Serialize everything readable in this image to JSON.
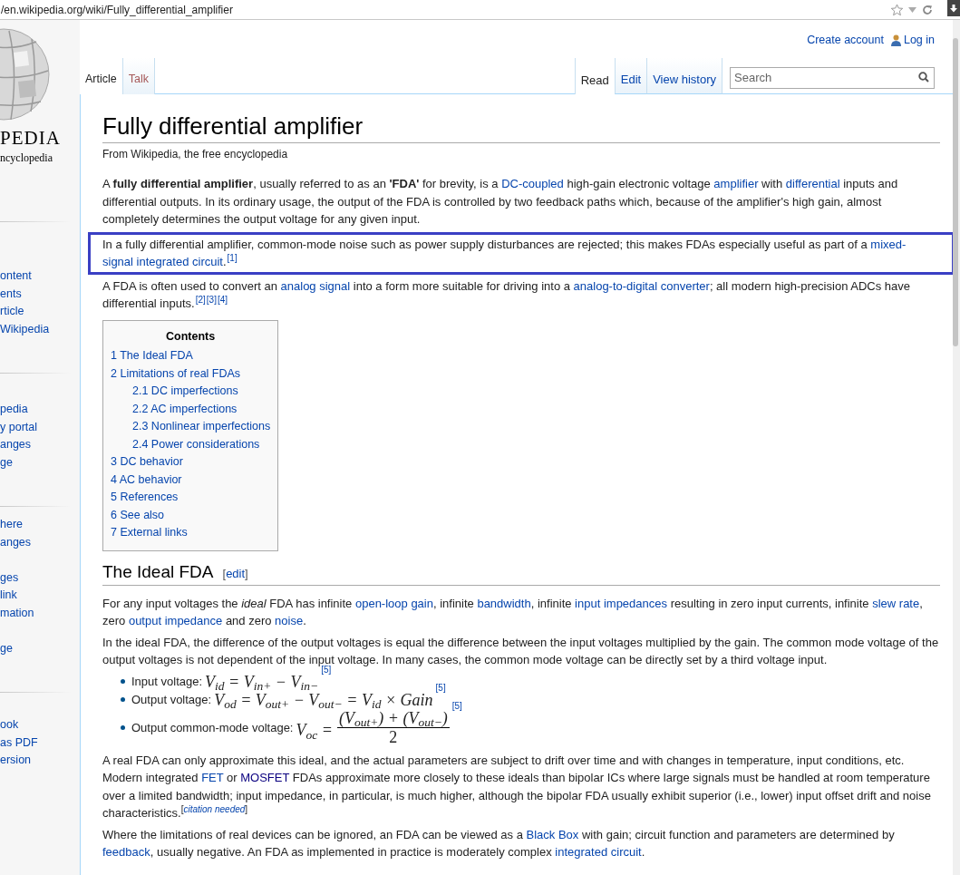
{
  "browser": {
    "url": "/en.wikipedia.org/wiki/Fully_differential_amplifier"
  },
  "logo": {
    "wordmark": "PEDIA",
    "tagline": "ncyclopedia"
  },
  "sidebar": {
    "sections": [
      {
        "items": [
          {
            "label": "ontent"
          },
          {
            "label": "ents"
          },
          {
            "label": "rticle"
          },
          {
            "label": "Wikipedia"
          }
        ]
      },
      {
        "items": [
          {
            "label": "pedia"
          },
          {
            "label": "y portal"
          },
          {
            "label": "anges"
          },
          {
            "label": "ge"
          }
        ]
      },
      {
        "items": [
          {
            "label": "here"
          },
          {
            "label": "anges"
          },
          {
            "label": "ges",
            "gap_before": true
          },
          {
            "label": "link"
          },
          {
            "label": "mation"
          },
          {
            "label": "ge",
            "gap_before": true
          }
        ]
      },
      {
        "items": [
          {
            "label": "ook"
          },
          {
            "label": "as PDF"
          },
          {
            "label": "ersion"
          }
        ]
      }
    ]
  },
  "personal": {
    "create_account": "Create account",
    "log_in": "Log in"
  },
  "tabs_left": [
    {
      "label": "Article",
      "selected": true,
      "missing": false
    },
    {
      "label": "Talk",
      "selected": false,
      "missing": true
    }
  ],
  "tabs_right": [
    {
      "label": "Read",
      "selected": true
    },
    {
      "label": "Edit",
      "selected": false
    },
    {
      "label": "View history",
      "selected": false
    }
  ],
  "search": {
    "placeholder": "Search"
  },
  "title": "Fully differential amplifier",
  "tagline": "From Wikipedia, the free encyclopedia",
  "intro": [
    {
      "highlighted": false,
      "segments": [
        {
          "kind": "text",
          "text": "A "
        },
        {
          "kind": "bold",
          "text": "fully differential amplifier"
        },
        {
          "kind": "text",
          "text": ", usually referred to as an "
        },
        {
          "kind": "bold",
          "text": "'FDA'"
        },
        {
          "kind": "text",
          "text": " for brevity, is a "
        },
        {
          "kind": "link",
          "text": "DC-coupled"
        },
        {
          "kind": "text",
          "text": " high-gain electronic voltage "
        },
        {
          "kind": "link",
          "text": "amplifier"
        },
        {
          "kind": "text",
          "text": " with "
        },
        {
          "kind": "link",
          "text": "differential"
        },
        {
          "kind": "text",
          "text": " inputs and differential outputs. In its ordinary usage, the output of the FDA is controlled by two feedback paths which, because of the amplifier's high gain, almost completely determines the output voltage for any given input."
        }
      ]
    },
    {
      "highlighted": true,
      "segments": [
        {
          "kind": "text",
          "text": "In a fully differential amplifier, common-mode noise such as power supply disturbances are rejected; this makes FDAs especially useful as part of a "
        },
        {
          "kind": "link",
          "text": "mixed-"
        },
        {
          "kind": "link",
          "text": "signal integrated circuit"
        },
        {
          "kind": "text",
          "text": "."
        },
        {
          "kind": "ref",
          "text": "[1]"
        }
      ]
    },
    {
      "highlighted": false,
      "segments": [
        {
          "kind": "text",
          "text": "A FDA is often used to convert an "
        },
        {
          "kind": "link",
          "text": "analog signal"
        },
        {
          "kind": "text",
          "text": " into a form more suitable for driving into a "
        },
        {
          "kind": "link",
          "text": "analog-to-digital converter"
        },
        {
          "kind": "text",
          "text": "; all modern high-precision ADCs have differential inputs."
        },
        {
          "kind": "ref",
          "text": "[2]"
        },
        {
          "kind": "ref",
          "text": "[3]"
        },
        {
          "kind": "ref",
          "text": "[4]"
        }
      ]
    }
  ],
  "toc": {
    "title": "Contents",
    "items": [
      {
        "label": "1 The Ideal FDA"
      },
      {
        "label": "2 Limitations of real FDAs",
        "children": [
          {
            "label": "2.1 DC imperfections"
          },
          {
            "label": "2.2 AC imperfections"
          },
          {
            "label": "2.3 Nonlinear imperfections"
          },
          {
            "label": "2.4 Power considerations"
          }
        ]
      },
      {
        "label": "3 DC behavior"
      },
      {
        "label": "4 AC behavior"
      },
      {
        "label": "5 References"
      },
      {
        "label": "6 See also"
      },
      {
        "label": "7 External links"
      }
    ]
  },
  "section": {
    "heading": "The Ideal FDA",
    "edit": {
      "open": "[",
      "link": "edit",
      "close": "]"
    },
    "before": [
      {
        "highlighted": false,
        "segments": [
          {
            "kind": "text",
            "text": "For any input voltages the "
          },
          {
            "kind": "italic",
            "text": "ideal"
          },
          {
            "kind": "text",
            "text": " FDA has infinite "
          },
          {
            "kind": "link",
            "text": "open-loop gain"
          },
          {
            "kind": "text",
            "text": ", infinite "
          },
          {
            "kind": "link",
            "text": "bandwidth"
          },
          {
            "kind": "text",
            "text": ", infinite "
          },
          {
            "kind": "link",
            "text": "input impedances"
          },
          {
            "kind": "text",
            "text": " resulting in zero input currents, infinite "
          },
          {
            "kind": "link",
            "text": "slew rate"
          },
          {
            "kind": "text",
            "text": ", zero "
          },
          {
            "kind": "link",
            "text": "output impedance"
          },
          {
            "kind": "text",
            "text": " and zero "
          },
          {
            "kind": "link",
            "text": "noise"
          },
          {
            "kind": "text",
            "text": "."
          }
        ]
      },
      {
        "highlighted": false,
        "segments": [
          {
            "kind": "text",
            "text": "In the ideal FDA, the difference of the output voltages is equal the difference between the input voltages multiplied by the gain. The common mode voltage of the output voltages is not dependent of the input voltage. In many cases, the common mode voltage can be directly set by a third voltage input."
          }
        ]
      }
    ],
    "formulas": [
      {
        "kind": "inline",
        "label": "Input voltage:",
        "formula": "V$_{id}$ = V$_{in+}$ − V$_{in−}$",
        "ref": "[5]"
      },
      {
        "kind": "inline",
        "label": "Output voltage:",
        "formula": "V$_{od}$ = V$_{out+}$ − V$_{out−}$ = V$_{id}$ × Gain",
        "ref": "[5]"
      },
      {
        "kind": "fraction",
        "label": "Output common-mode voltage:",
        "formula": "V$_{oc}$ =",
        "numerator": "(V$_{out+}$) + (V$_{out−}$)",
        "denominator": "2",
        "ref": "[5]"
      }
    ],
    "after": [
      {
        "highlighted": false,
        "segments": [
          {
            "kind": "text",
            "text": "A real FDA can only approximate this ideal, and the actual parameters are subject to drift over time and with changes in temperature, input conditions, etc. Modern integrated "
          },
          {
            "kind": "link",
            "text": "FET"
          },
          {
            "kind": "text",
            "text": " or "
          },
          {
            "kind": "link",
            "text": "MOSFET",
            "visited": true
          },
          {
            "kind": "text",
            "text": " FDAs approximate more closely to these ideals than bipolar ICs where large signals must be handled at room temperature over a limited bandwidth; input impedance, in particular, is much higher, although the bipolar FDA usually exhibit superior (i.e., lower) input offset drift and noise characteristics."
          },
          {
            "kind": "sup_text",
            "text": "["
          },
          {
            "kind": "citation",
            "text": "citation needed"
          },
          {
            "kind": "sup_text",
            "text": "]"
          }
        ]
      },
      {
        "highlighted": false,
        "segments": [
          {
            "kind": "text",
            "text": "Where the limitations of real devices can be ignored, an FDA can be viewed as a "
          },
          {
            "kind": "link",
            "text": "Black Box"
          },
          {
            "kind": "text",
            "text": " with gain; circuit function and parameters are determined by "
          },
          {
            "kind": "link",
            "text": "feedback"
          },
          {
            "kind": "text",
            "text": ", usually negative. An FDA as implemented in practice is moderately complex "
          },
          {
            "kind": "link",
            "text": "integrated circuit"
          },
          {
            "kind": "text",
            "text": "."
          }
        ]
      }
    ]
  }
}
